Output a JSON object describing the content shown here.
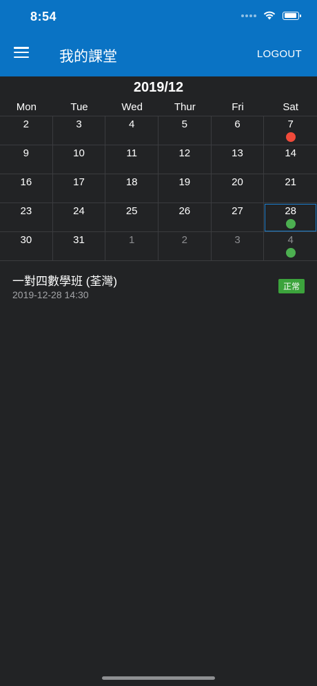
{
  "status_bar": {
    "time": "8:54"
  },
  "app_bar": {
    "title": "我的課堂",
    "logout_label": "LOGOUT"
  },
  "calendar": {
    "month": "2019/12",
    "weekdays": [
      "Mon",
      "Tue",
      "Wed",
      "Thur",
      "Fri",
      "Sat"
    ],
    "weeks": [
      [
        {
          "day": "2"
        },
        {
          "day": "3"
        },
        {
          "day": "4"
        },
        {
          "day": "5"
        },
        {
          "day": "6"
        },
        {
          "day": "7",
          "marker": "#f04a3a"
        }
      ],
      [
        {
          "day": "9"
        },
        {
          "day": "10"
        },
        {
          "day": "11"
        },
        {
          "day": "12"
        },
        {
          "day": "13"
        },
        {
          "day": "14"
        }
      ],
      [
        {
          "day": "16"
        },
        {
          "day": "17"
        },
        {
          "day": "18"
        },
        {
          "day": "19"
        },
        {
          "day": "20"
        },
        {
          "day": "21"
        }
      ],
      [
        {
          "day": "23"
        },
        {
          "day": "24"
        },
        {
          "day": "25"
        },
        {
          "day": "26"
        },
        {
          "day": "27"
        },
        {
          "day": "28",
          "marker": "#4caf50",
          "selected": true
        }
      ],
      [
        {
          "day": "30"
        },
        {
          "day": "31"
        },
        {
          "day": "1",
          "other": true
        },
        {
          "day": "2",
          "other": true
        },
        {
          "day": "3",
          "other": true
        },
        {
          "day": "4",
          "other": true,
          "marker": "#4caf50"
        }
      ]
    ]
  },
  "classes": [
    {
      "name": "一對四數學班 (荃灣)",
      "datetime": "2019-12-28 14:30",
      "status": "正常",
      "status_color": "#3ca33c"
    }
  ],
  "colors": {
    "app_bar": "#0a73c4",
    "background": "#222325",
    "marker_red": "#f04a3a",
    "marker_green": "#4caf50"
  },
  "icons": [
    "menu-icon",
    "wifi-icon",
    "battery-icon",
    "signal-icon"
  ]
}
